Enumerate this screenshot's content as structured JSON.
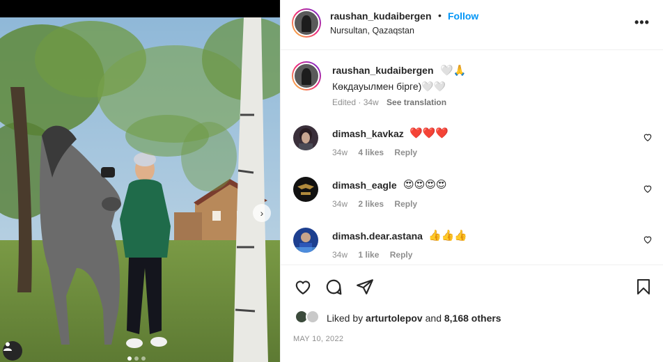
{
  "post": {
    "username": "raushan_kudaibergen",
    "separator": "•",
    "follow_label": "Follow",
    "location": "Nursultan, Qazaqstan",
    "more_label": "•••"
  },
  "caption": {
    "username": "raushan_kudaibergen",
    "emoji": "🤍🙏",
    "text": "Көкдауылмен бірге)🤍🤍",
    "edited": "Edited · 34w",
    "see_translation": "See translation"
  },
  "comments": [
    {
      "username": "dimash_kavkaz",
      "emoji": "❤️❤️❤️",
      "age": "34w",
      "likes": "4 likes",
      "reply": "Reply"
    },
    {
      "username": "dimash_eagle",
      "emoji": "😍😍😍😍",
      "age": "34w",
      "likes": "2 likes",
      "reply": "Reply"
    },
    {
      "username": "dimash.dear.astana",
      "emoji": "👍👍👍",
      "age": "34w",
      "likes": "1 like",
      "reply": "Reply"
    }
  ],
  "likes": {
    "prefix": "Liked by",
    "user": "arturtolepov",
    "and": "and",
    "others": "8,168 others"
  },
  "date": "MAY 10, 2022",
  "icons": [
    "like-icon",
    "comment-icon",
    "share-icon",
    "save-icon",
    "next-arrow-icon",
    "tag-user-icon",
    "more-icon"
  ]
}
